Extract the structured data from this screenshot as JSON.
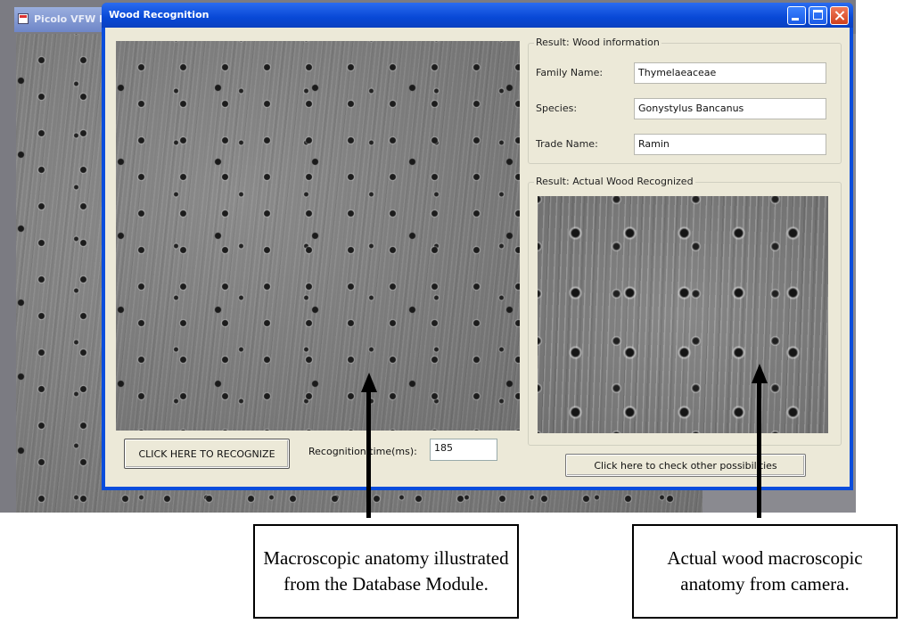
{
  "background_window": {
    "title": "Picolo VFW D"
  },
  "dialog": {
    "title": "Wood Recognition",
    "recognize_button": "CLICK HERE TO RECOGNIZE",
    "recognition_time_label": "Recognition time(ms):",
    "recognition_time_value": "185",
    "wood_info_group": {
      "legend": "Result: Wood information",
      "family_label": "Family Name:",
      "family_value": "Thymelaeaceae",
      "species_label": "Species:",
      "species_value": "Gonystylus Bancanus",
      "trade_label": "Trade Name:",
      "trade_value": "Ramin"
    },
    "actual_group": {
      "legend": "Result: Actual Wood Recognized"
    },
    "other_possibilities_button": "Click here to check other possibilities"
  },
  "captions": {
    "database": "Macroscopic anatomy illustrated from the Database Module.",
    "camera": "Actual wood macroscopic anatomy from camera."
  }
}
